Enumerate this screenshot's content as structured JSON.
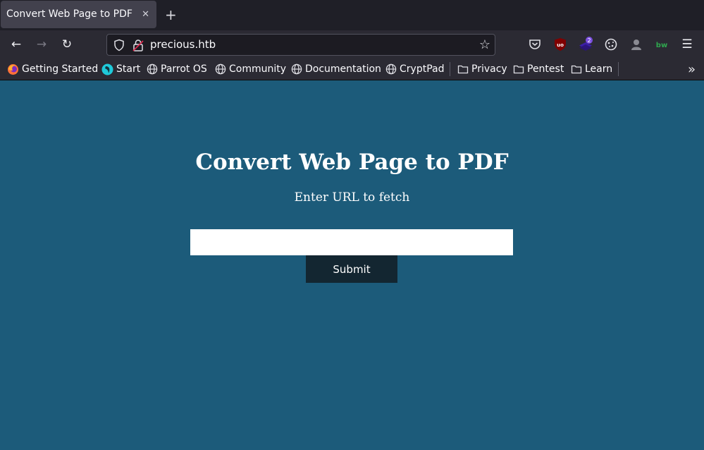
{
  "browser": {
    "tab": {
      "title": "Convert Web Page to PDF",
      "close": "✕"
    },
    "new_tab": "+",
    "nav": {
      "back": "←",
      "forward": "→",
      "reload": "↻"
    },
    "url": "precious.htb",
    "star": "☆",
    "extensions": {
      "ublock_badge": "2",
      "bitwarden_label": "bw"
    },
    "menu": "☰"
  },
  "bookmarks": [
    {
      "label": "Getting Started",
      "icon": "firefox-icon"
    },
    {
      "label": "Start",
      "icon": "parrot-icon"
    },
    {
      "label": "Parrot OS",
      "icon": "globe-icon"
    },
    {
      "label": "Community",
      "icon": "globe-icon"
    },
    {
      "label": "Documentation",
      "icon": "globe-icon"
    },
    {
      "label": "CryptPad",
      "icon": "globe-icon"
    },
    {
      "label": "Privacy",
      "icon": "folder-icon"
    },
    {
      "label": "Pentest",
      "icon": "folder-icon"
    },
    {
      "label": "Learn",
      "icon": "folder-icon"
    }
  ],
  "bookmarks_overflow": "»",
  "page": {
    "title": "Convert Web Page to PDF",
    "subtitle": "Enter URL to fetch",
    "url_input_value": "",
    "submit_label": "Submit"
  },
  "colors": {
    "page_background": "#1c5b7a",
    "submit_background": "#132631",
    "toolbar": "#2b2a33"
  }
}
